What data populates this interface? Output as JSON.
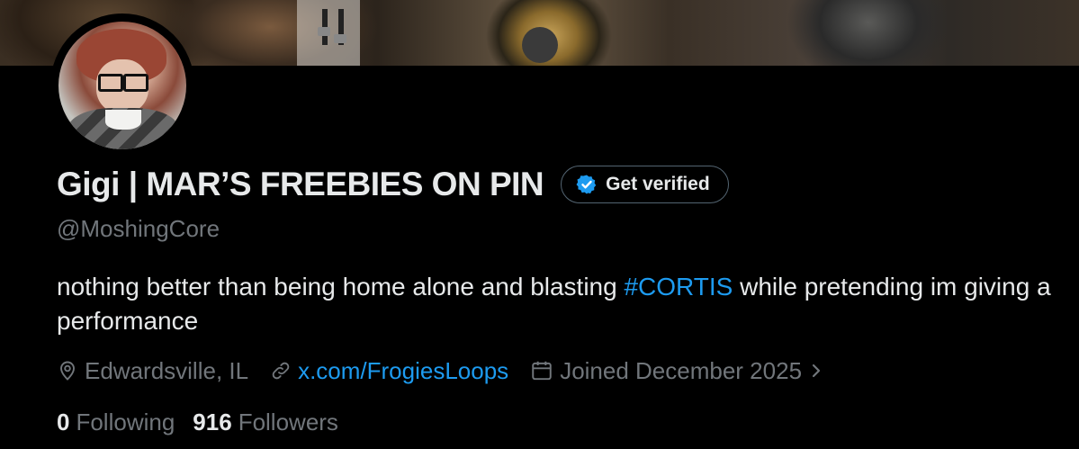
{
  "profile": {
    "display_name": "Gigi | MAR’S FREEBIES ON PIN",
    "get_verified_label": "Get verified",
    "handle": "@MoshingCore",
    "bio": {
      "before": "nothing better than being home alone and blasting ",
      "hashtag": "#CORTIS",
      "after": " while pretending im giving a performance"
    },
    "location": "Edwardsville, IL",
    "website": "x.com/FrogiesLoops",
    "joined": "Joined December 2025",
    "following_count": "0",
    "following_label": "Following",
    "followers_count": "916",
    "followers_label": "Followers"
  },
  "icons": {
    "verified_badge": "verified-badge-icon",
    "location": "location-pin-icon",
    "link": "link-icon",
    "calendar": "calendar-icon",
    "joined_chevron": "chevron-right-icon"
  },
  "colors": {
    "background": "#000000",
    "text_primary": "#e7e9ea",
    "text_secondary": "#71767b",
    "accent": "#1d9bf0",
    "border": "#536471"
  }
}
